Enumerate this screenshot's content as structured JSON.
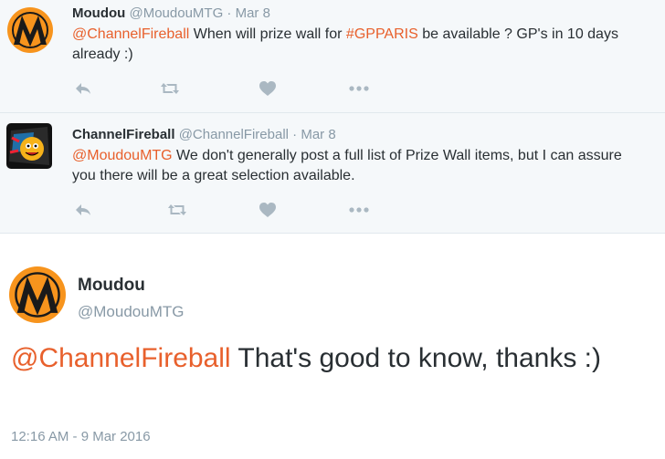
{
  "reply1": {
    "fullname": "Moudou",
    "username": "@MoudouMTG",
    "dot": "·",
    "time": "Mar 8",
    "mention": "@ChannelFireball",
    "text_a": " When will prize wall for ",
    "hashtag": "#GPPARIS",
    "text_b": " be available ? GP's in 10 days already :)",
    "icons": [
      "reply-icon",
      "retweet-icon",
      "like-icon",
      "more-icon"
    ]
  },
  "reply2": {
    "fullname": "ChannelFireball",
    "username": "@ChannelFireball",
    "dot": "·",
    "time": "Mar 8",
    "mention": "@MoudouMTG",
    "text": " We don't generally post a full list of Prize Wall items, but I can assure you there will be a great selection available.",
    "icons": [
      "reply-icon",
      "retweet-icon",
      "like-icon",
      "more-icon"
    ]
  },
  "main_tweet": {
    "fullname": "Moudou",
    "username": "@MoudouMTG",
    "mention": "@ChannelFireball",
    "text": " That's good to know, thanks :)",
    "timestamp": "12:16 AM - 9 Mar 2016"
  },
  "colors": {
    "accent": "#e8602c",
    "muted": "#8899a6",
    "text": "#292f33",
    "reply_bg": "#f5f8fa",
    "avatar_orange": "#f7941d"
  }
}
